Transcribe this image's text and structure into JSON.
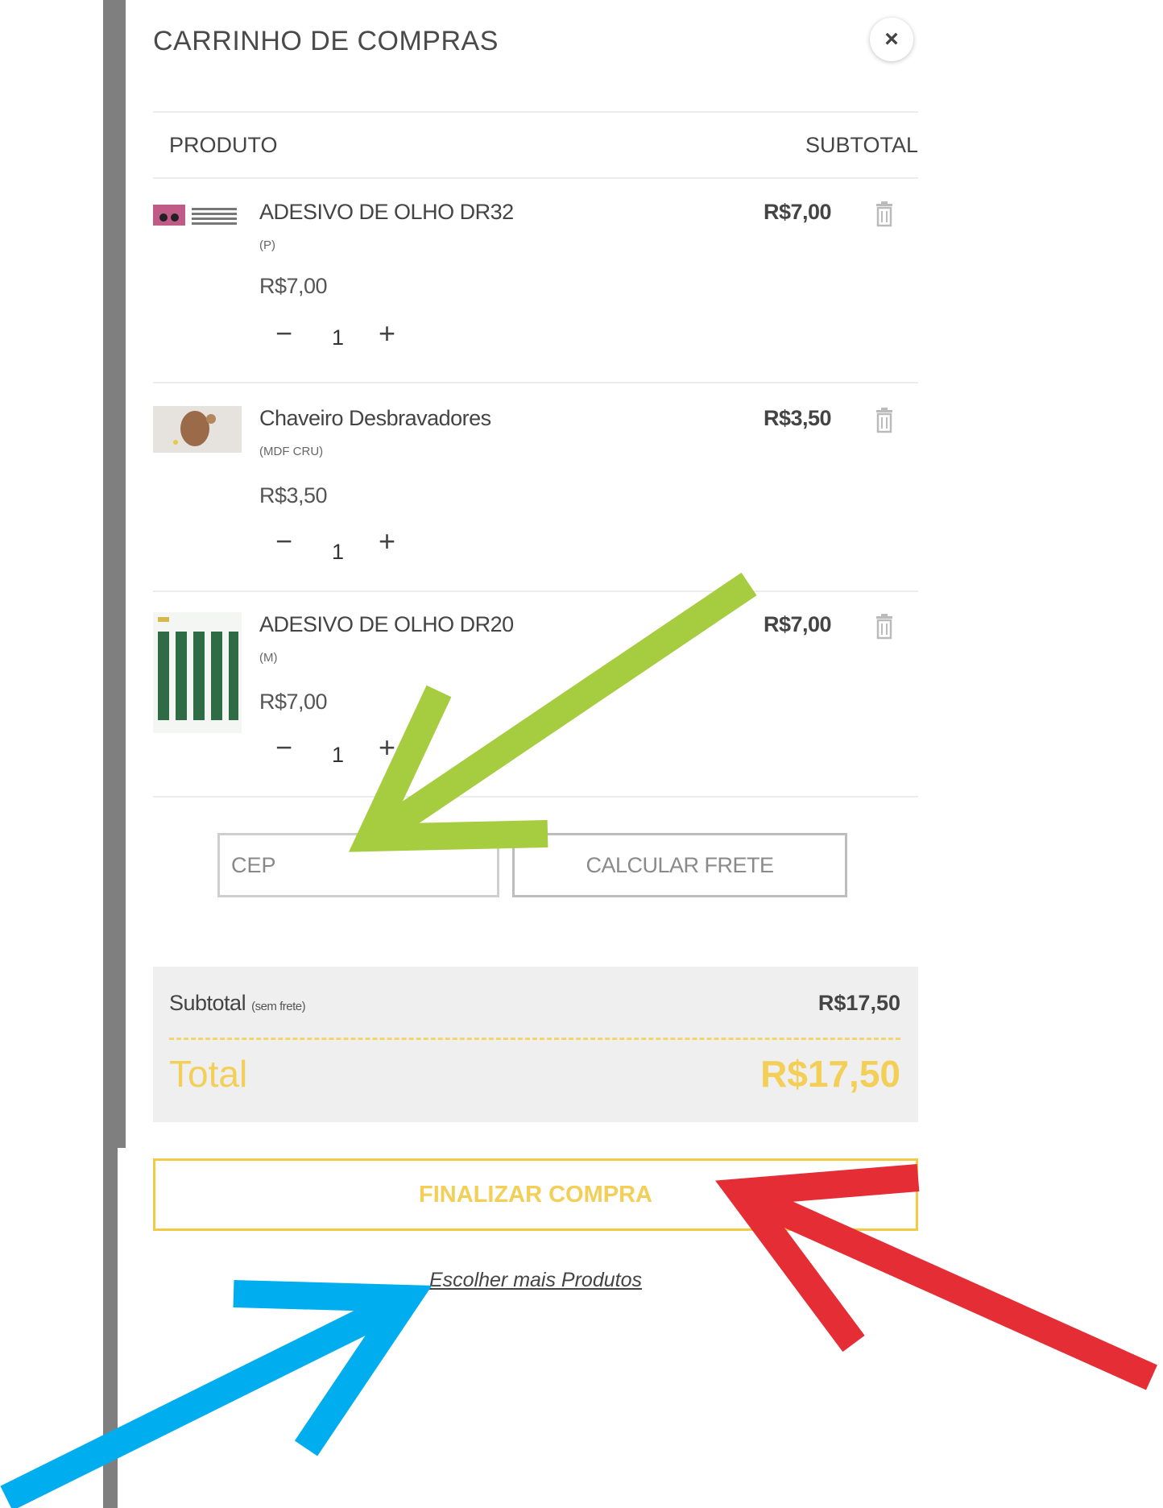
{
  "cart": {
    "title": "CARRINHO DE COMPRAS",
    "close_icon": "×",
    "columns": {
      "product": "PRODUTO",
      "subtotal": "SUBTOTAL"
    },
    "items": [
      {
        "name": "ADESIVO DE OLHO DR32",
        "variant": "(P)",
        "price": "R$7,00",
        "quantity": "1",
        "subtotal": "R$7,00",
        "minus": "−",
        "plus": "+"
      },
      {
        "name": "Chaveiro Desbravadores",
        "variant": "(MDF CRU)",
        "price": "R$3,50",
        "quantity": "1",
        "subtotal": "R$3,50",
        "minus": "−",
        "plus": "+"
      },
      {
        "name": "ADESIVO DE OLHO DR20",
        "variant": "(M)",
        "price": "R$7,00",
        "quantity": "1",
        "subtotal": "R$7,00",
        "minus": "−",
        "plus": "+"
      }
    ],
    "shipping": {
      "cep_placeholder": "CEP",
      "calculate_label": "CALCULAR FRETE"
    },
    "summary": {
      "subtotal_label": "Subtotal",
      "subtotal_note": "(sem frete)",
      "subtotal_value": "R$17,50",
      "total_label": "Total",
      "total_value": "R$17,50"
    },
    "checkout_label": "FINALIZAR COMPRA",
    "more_products_label": "Escolher mais Produtos"
  },
  "annotation_arrows": [
    {
      "color": "#a6cc3f",
      "target": "cep-input"
    },
    {
      "color": "#e52d35",
      "target": "checkout-button"
    },
    {
      "color": "#00aeef",
      "target": "more-products-link"
    }
  ],
  "colors": {
    "accent_yellow": "#f3cf57",
    "panel_gray": "#efefef",
    "sidebar_gray": "#7f7f7f"
  }
}
